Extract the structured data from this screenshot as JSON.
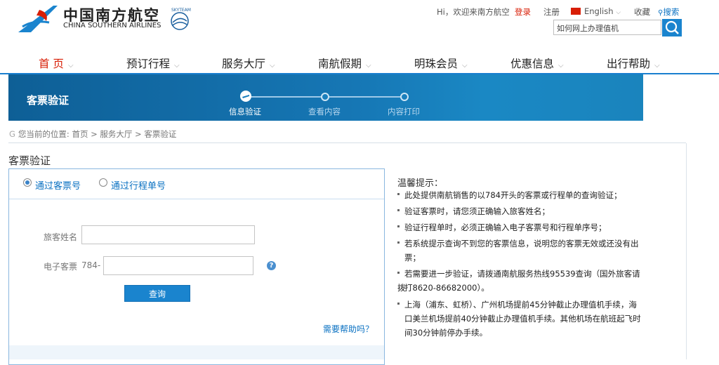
{
  "header": {
    "logo_cn": "中国南方航空",
    "logo_en": "CHINA SOUTHERN AIRLINES",
    "skyteam": "SKYTEAM",
    "greeting": "Hi，欢迎来南方航空",
    "login": "登录",
    "register": "注册",
    "language": "English",
    "favorite": "收藏",
    "search_link": "搜索",
    "search_value": "如何网上办理值机"
  },
  "nav": {
    "items": [
      "首 页",
      "预订行程",
      "服务大厅",
      "南航假期",
      "明珠会员",
      "优惠信息",
      "出行帮助"
    ]
  },
  "banner": {
    "title": "客票验证",
    "steps": [
      "信息验证",
      "查看内容",
      "内容打印"
    ]
  },
  "breadcrumb": "您当前的位置: 首页 > 服务大厅 > 客票验证",
  "section_title": "客票验证",
  "form": {
    "tab_ticket": "通过客票号",
    "tab_itinerary": "通过行程单号",
    "name_label": "旅客姓名",
    "ticket_label": "电子客票",
    "ticket_prefix": "784-",
    "help_icon": "?",
    "submit": "查询",
    "help_link": "需要帮助吗？"
  },
  "tips": {
    "title": "温馨提示：",
    "items": [
      "此处提供南航销售的以784开头的客票或行程单的查询验证；",
      "验证客票时，请您须正确输入旅客姓名；",
      "验证行程单时，必须正确输入电子客票号和行程单序号；",
      "若系统提示查询不到您的客票信息，说明您的客票无效或还没有出",
      "票；",
      "若需要进一步验证，请拨通南航服务热线95539查询（国外旅客请拨",
      "打8620-86682000）。",
      "上海（浦东、虹桥）、广州机场提前45分钟截止办理值机手续，海",
      "口美兰机场提前40分钟截止办理值机手续。其他机场在航班起飞时",
      "间30分钟前停办手续。"
    ]
  },
  "colors": {
    "accent_red": "#d81e06",
    "brand_blue": "#1a84ce",
    "link_blue": "#0a71c2"
  }
}
